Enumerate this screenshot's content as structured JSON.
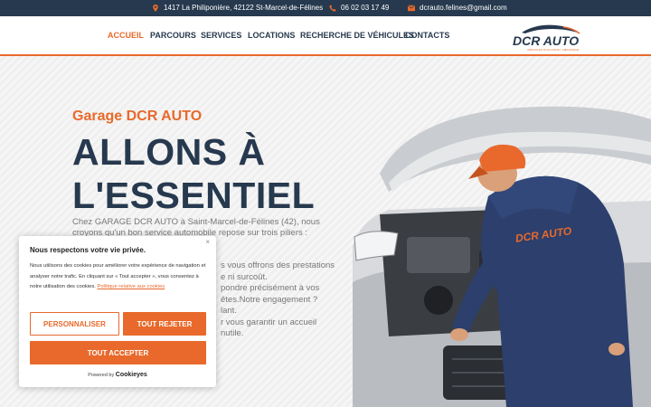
{
  "topbar": {
    "address": "1417 La Philiponière, 42122 St-Marcel-de-Félines",
    "phone": "06 02 03 17 49",
    "email": "dcrauto.felines@gmail.com"
  },
  "nav": {
    "items": [
      "ACCUEIL",
      "PARCOURS",
      "SERVICES",
      "LOCATIONS",
      "RECHERCHE DE VÉHICULES",
      "CONTACTS"
    ],
    "active_index": 0
  },
  "logo": {
    "text": "DCR AUTO",
    "tagline": "VÉHICULES D'OCCASION - MÉCANIQUE"
  },
  "hero": {
    "kicker": "Garage DCR AUTO",
    "headline_line1": "ALLONS À",
    "headline_line2": "L'ESSENTIEL",
    "intro": "Chez GARAGE DCR AUTO à Saint-Marcel-de-Félines (42), nous croyons qu'un bon service automobile repose sur trois piliers :",
    "partial_lines": [
      "s vous offrons des prestations",
      "e ni surcoût.",
      "pondre précisément à vos",
      "êtes.Notre engagement ?",
      "lant.",
      "r vous garantir un accueil",
      "nutile."
    ]
  },
  "cookie": {
    "title": "Nous respectons votre vie privée.",
    "body": "Nous utilisons des cookies pour améliorer votre expérience de navigation et analyser notre trafic. En cliquant sur « Tout accepter », vous consentez à notre utilisation des cookies.",
    "policy_link": "Politique relative aux cookies",
    "customize": "PERSONNALISER",
    "reject": "TOUT REJETER",
    "accept": "TOUT ACCEPTER",
    "powered_by": "Powered by",
    "brand": "Cookieyes",
    "close_glyph": "×"
  },
  "colors": {
    "accent": "#e8692b",
    "navy": "#27394e"
  }
}
